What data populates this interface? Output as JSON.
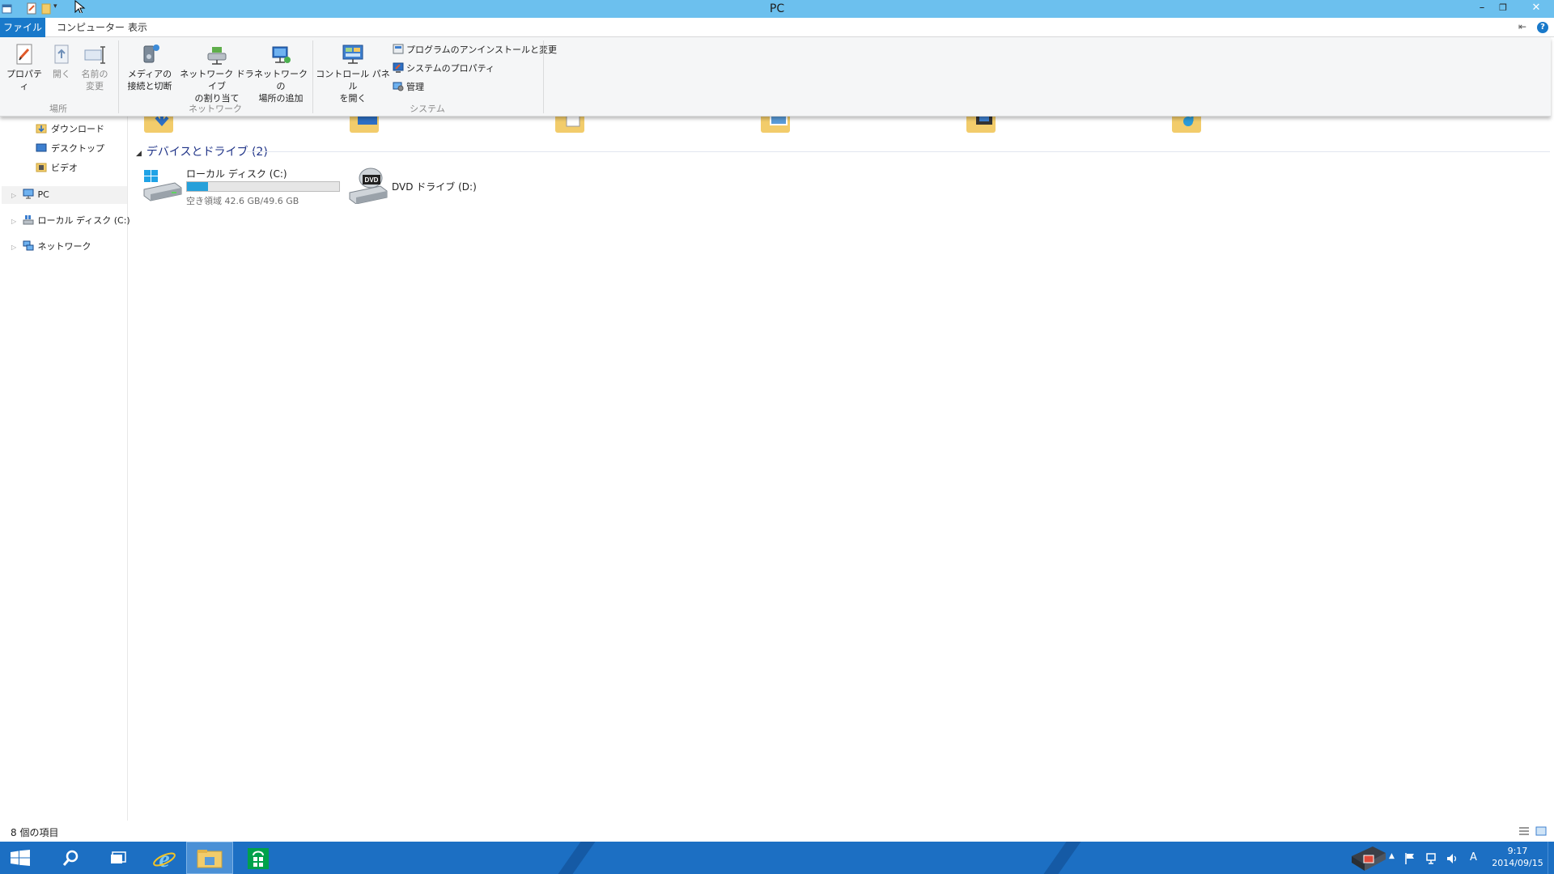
{
  "window": {
    "title": "PC"
  },
  "tabs": {
    "file": "ファイル",
    "computer": "コンピューター",
    "view": "表示"
  },
  "ribbon": {
    "properties": "プロパティ",
    "open": "開く",
    "rename_1": "名前の",
    "rename_2": "変更",
    "group_location": "場所",
    "media_1": "メディアの",
    "media_2": "接続と切断",
    "mapdrive_1": "ネットワーク ドライブ",
    "mapdrive_2": "の割り当て",
    "addnet_1": "ネットワークの",
    "addnet_2": "場所の追加",
    "group_network": "ネットワーク",
    "control_1": "コントロール パネル",
    "control_2": "を開く",
    "uninstall": "プログラムのアンインストールと変更",
    "sysprops": "システムのプロパティ",
    "manage": "管理",
    "group_system": "システム"
  },
  "nav": {
    "downloads": "ダウンロード",
    "desktop": "デスクトップ",
    "videos": "ビデオ",
    "pc": "PC",
    "local_disk": "ローカル ディスク (C:)",
    "network": "ネットワーク"
  },
  "content": {
    "section_header": "デバイスとドライブ (2)",
    "drive_c_name": "ローカル ディスク (C:)",
    "drive_c_free": "空き領域 42.6 GB/49.6 GB",
    "drive_c_used_fraction": 0.14,
    "drive_d_name": "DVD ドライブ (D:)"
  },
  "status": {
    "item_count": "8 個の項目"
  },
  "taskbar": {
    "time": "9:17",
    "date": "2014/09/15",
    "ime": "A"
  },
  "colors": {
    "accent": "#1979ca",
    "titlebar": "#6cc0ee",
    "taskbar": "#1c6fc3",
    "progress": "#26a0da"
  }
}
